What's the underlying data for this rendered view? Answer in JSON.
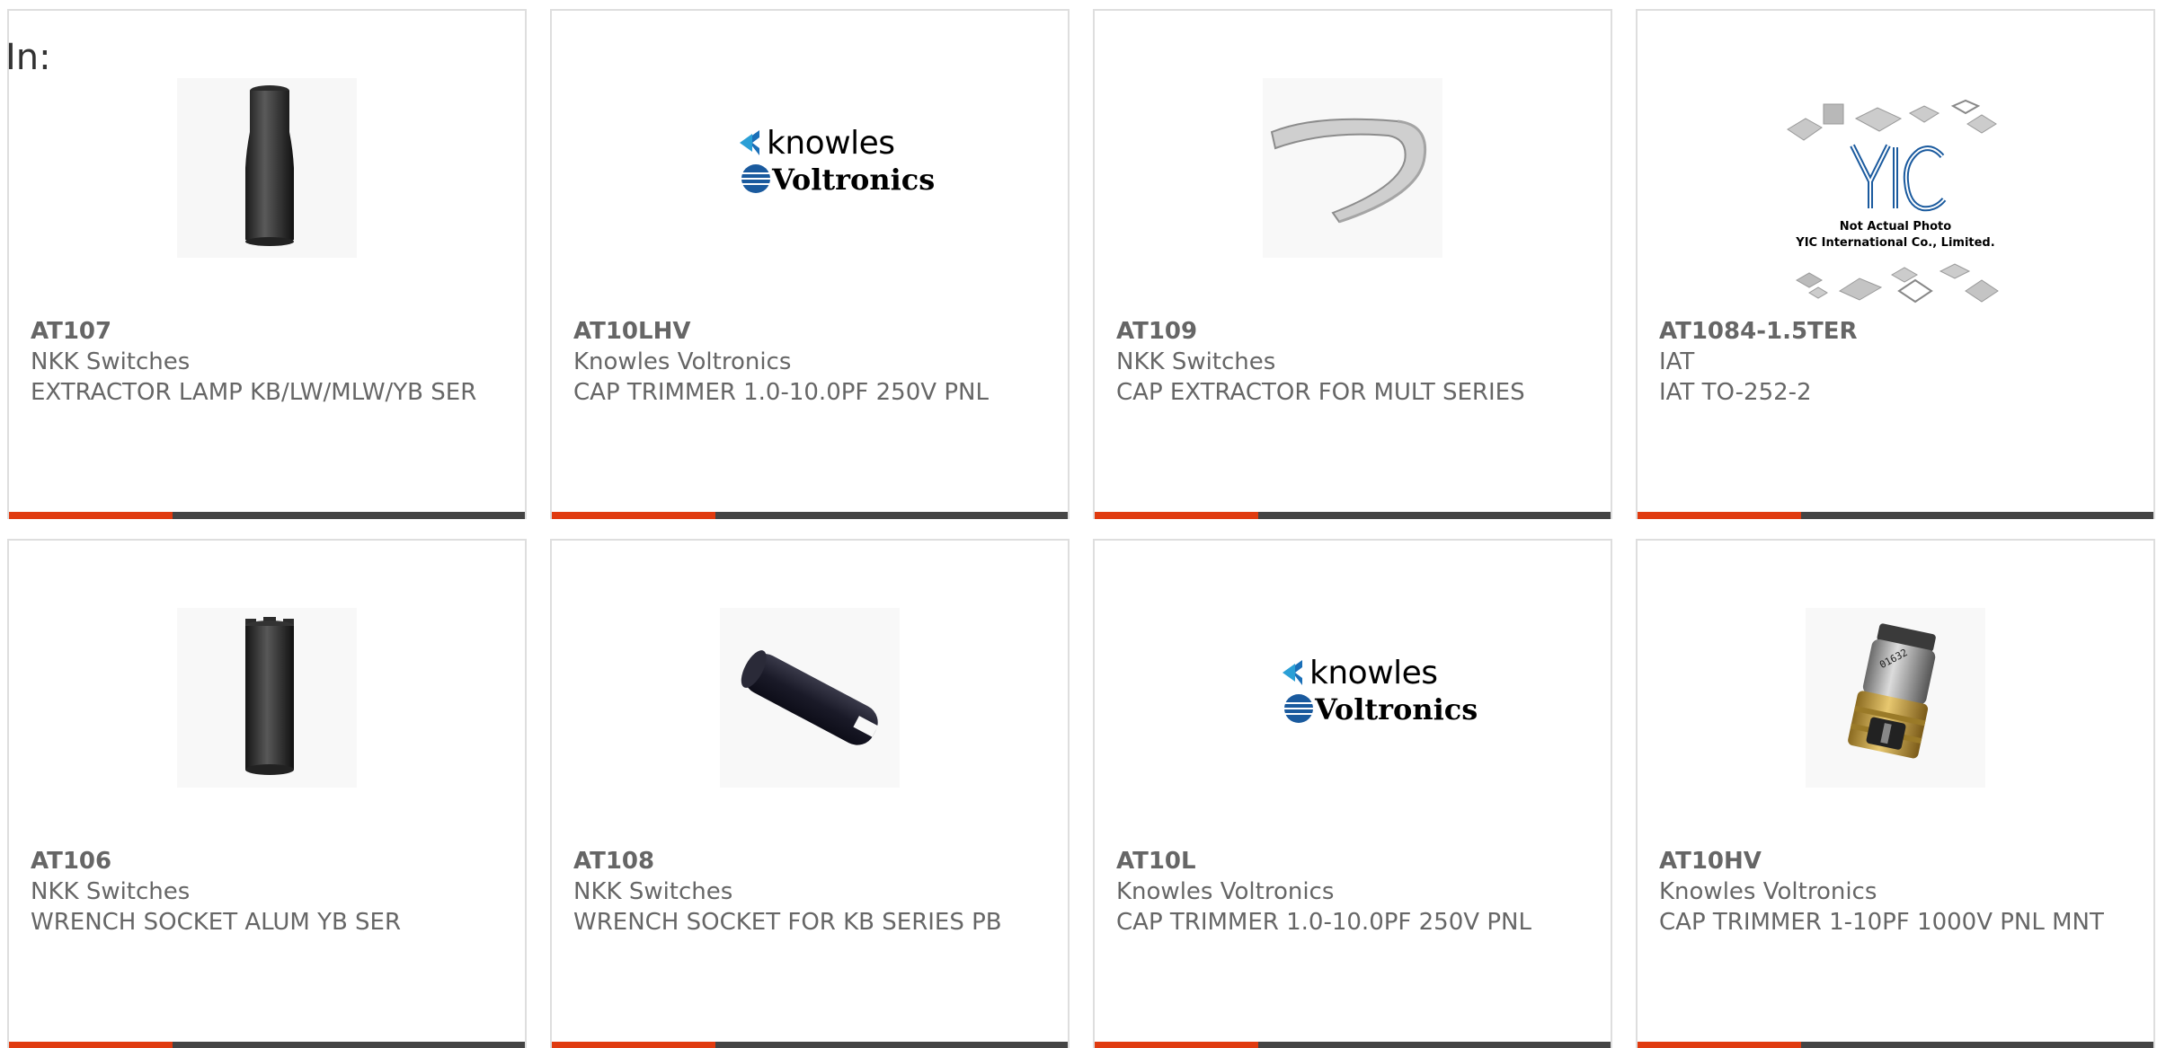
{
  "header": {
    "filter_label": "In:"
  },
  "colors": {
    "accent": "#e03b10",
    "bar": "#444444",
    "text": "#666666",
    "knowles_blue": "#2a9fd6",
    "voltronics_blue": "#1a5a9e"
  },
  "products": [
    {
      "part_number": "AT107",
      "manufacturer": "NKK Switches",
      "description": "EXTRACTOR LAMP KB/LW/MLW/YB SER",
      "image_type": "extractor-lamp-photo"
    },
    {
      "part_number": "AT10LHV",
      "manufacturer": "Knowles Voltronics",
      "description": "CAP TRIMMER 1.0-10.0PF 250V PNL",
      "image_type": "knowles-voltronics-logo",
      "logo_top": "knowles",
      "logo_bottom": "Voltronics"
    },
    {
      "part_number": "AT109",
      "manufacturer": "NKK Switches",
      "description": "CAP EXTRACTOR FOR MULT SERIES",
      "image_type": "cap-extractor-photo"
    },
    {
      "part_number": "AT1084-1.5TER",
      "manufacturer": "IAT",
      "description": "IAT TO-252-2",
      "image_type": "yic-placeholder",
      "logo_text": "YIC",
      "caption_line1": "Not Actual Photo",
      "caption_line2": "YIC International Co., Limited."
    },
    {
      "part_number": "AT106",
      "manufacturer": "NKK Switches",
      "description": "WRENCH SOCKET ALUM YB SER",
      "image_type": "wrench-socket-photo"
    },
    {
      "part_number": "AT108",
      "manufacturer": "NKK Switches",
      "description": "WRENCH SOCKET FOR KB SERIES PB",
      "image_type": "wrench-socket-kb-photo"
    },
    {
      "part_number": "AT10L",
      "manufacturer": "Knowles Voltronics",
      "description": "CAP TRIMMER 1.0-10.0PF 250V PNL",
      "image_type": "knowles-voltronics-logo",
      "logo_top": "knowles",
      "logo_bottom": "Voltronics"
    },
    {
      "part_number": "AT10HV",
      "manufacturer": "Knowles Voltronics",
      "description": "CAP TRIMMER 1-10PF 1000V PNL MNT",
      "image_type": "cap-trimmer-photo"
    }
  ]
}
